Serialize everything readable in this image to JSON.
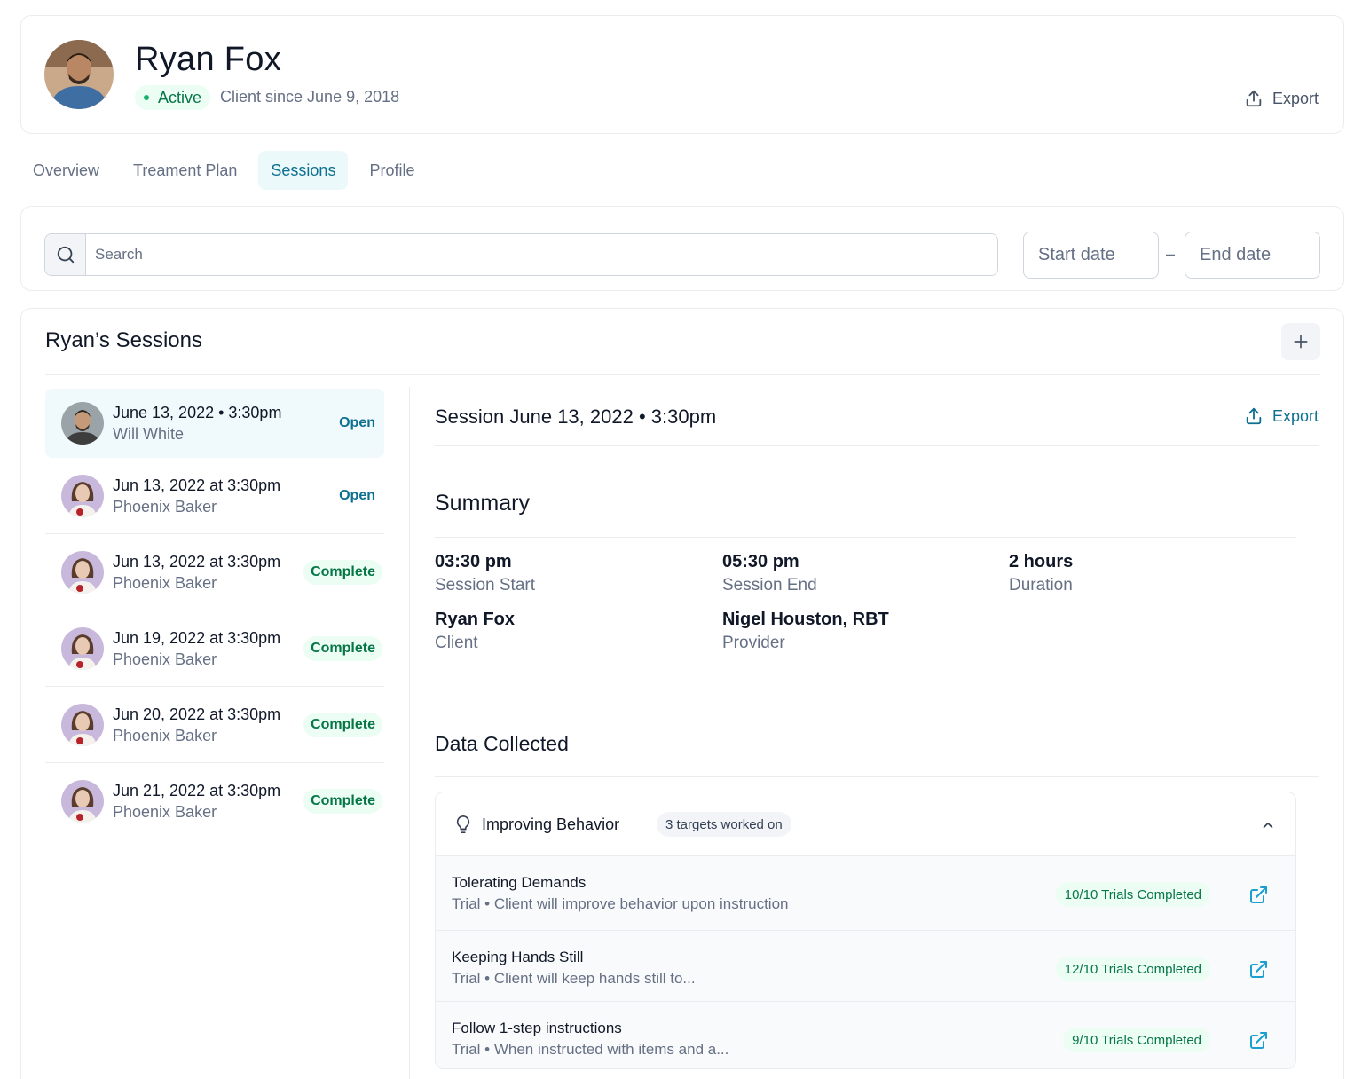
{
  "client": {
    "name": "Ryan Fox",
    "status": "Active",
    "since": "Client since June 9, 2018",
    "export_label": "Export"
  },
  "tabs": [
    {
      "label": "Overview",
      "active": false
    },
    {
      "label": "Treament Plan",
      "active": false
    },
    {
      "label": "Sessions",
      "active": true
    },
    {
      "label": "Profile",
      "active": false
    }
  ],
  "filters": {
    "search_placeholder": "Search",
    "start_date_placeholder": "Start date",
    "separator": "–",
    "end_date_placeholder": "End date"
  },
  "sessions_panel": {
    "title": "Ryan’s Sessions",
    "add_icon": "plus-icon",
    "items": [
      {
        "date": "June 13, 2022 • 3:30pm",
        "provider": "Will White",
        "status": "Open",
        "selected": true
      },
      {
        "date": "Jun 13, 2022 at 3:30pm",
        "provider": "Phoenix Baker",
        "status": "Open",
        "selected": false
      },
      {
        "date": "Jun 13, 2022 at 3:30pm",
        "provider": "Phoenix Baker",
        "status": "Complete",
        "selected": false
      },
      {
        "date": "Jun 19, 2022 at 3:30pm",
        "provider": "Phoenix Baker",
        "status": "Complete",
        "selected": false
      },
      {
        "date": "Jun 20, 2022 at 3:30pm",
        "provider": "Phoenix Baker",
        "status": "Complete",
        "selected": false
      },
      {
        "date": "Jun 21, 2022 at 3:30pm",
        "provider": "Phoenix Baker",
        "status": "Complete",
        "selected": false
      }
    ]
  },
  "detail": {
    "title": "Session June 13, 2022 • 3:30pm",
    "export_label": "Export",
    "summary_title": "Summary",
    "summary": {
      "session_start": {
        "value": "03:30 pm",
        "label": "Session Start"
      },
      "session_end": {
        "value": "05:30 pm",
        "label": "Session End"
      },
      "duration": {
        "value": "2 hours",
        "label": "Duration"
      },
      "client": {
        "value": "Ryan Fox",
        "label": "Client"
      },
      "provider": {
        "value": "Nigel Houston, RBT",
        "label": "Provider"
      }
    },
    "data_title": "Data Collected",
    "group": {
      "icon": "lightbulb-icon",
      "name": "Improving Behavior",
      "count": "3 targets worked on",
      "expanded": true,
      "targets": [
        {
          "name": "Tolerating Demands",
          "desc": "Trial • Client will improve behavior upon instruction",
          "badge": "10/10 Trials Completed"
        },
        {
          "name": "Keeping Hands Still",
          "desc": "Trial • Client will keep hands still to...",
          "badge": "12/10 Trials Completed"
        },
        {
          "name": "Follow 1-step instructions",
          "desc": "Trial • When instructed with items and a...",
          "badge": "9/10 Trials Completed"
        }
      ]
    }
  },
  "colors": {
    "accent": "#0e7090",
    "success_text": "#067647",
    "success_bg": "#ecfdf3",
    "selected_row_bg": "#f0f9fb"
  }
}
